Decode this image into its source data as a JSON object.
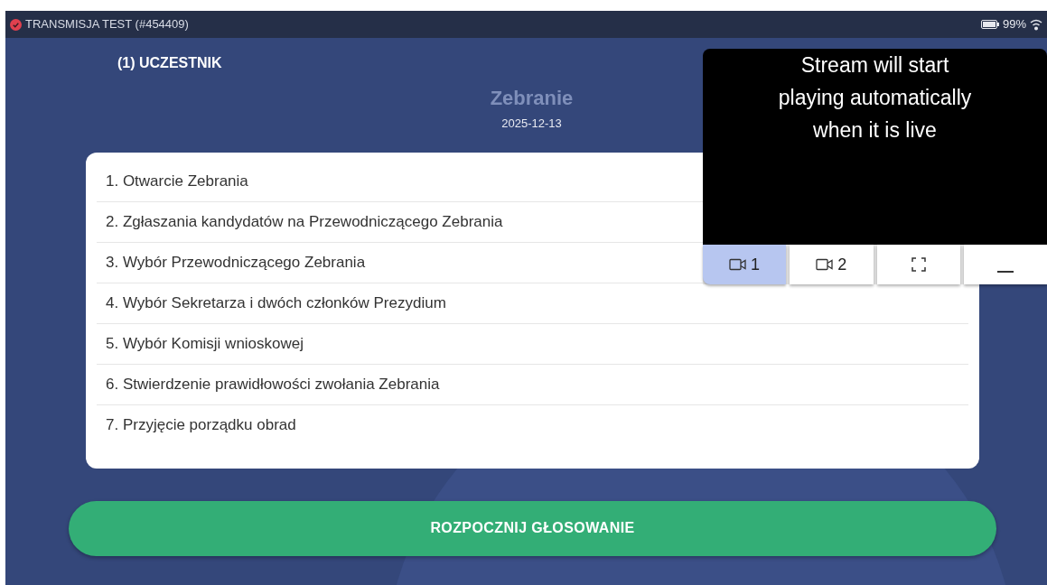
{
  "title_bar": {
    "title": "TRANSMISJA TEST (#454409)",
    "battery": "99%"
  },
  "participant": "(1) UCZESTNIK",
  "meeting": {
    "title": "Zebranie",
    "date": "2025-12-13"
  },
  "agenda": [
    "1. Otwarcie Zebrania",
    "2. Zgłaszania kandydatów na Przewodniczącego Zebrania",
    "3. Wybór Przewodniczącego Zebrania",
    "4. Wybór Sekretarza i dwóch członków Prezydium",
    "5. Wybór Komisji wnioskowej",
    "6. Stwierdzenie prawidłowości zwołania Zebrania",
    "7. Przyjęcie porządku obrad"
  ],
  "video": {
    "message": "Stream will start playing automatically when it is live",
    "controls": [
      {
        "kind": "camera",
        "label": "1",
        "selected": true
      },
      {
        "kind": "camera",
        "label": "2",
        "selected": false
      },
      {
        "kind": "fullscreen",
        "selected": false
      },
      {
        "kind": "minimize",
        "selected": false
      }
    ]
  },
  "action_button": "ROZPOCZNIJ GŁOSOWANIE"
}
